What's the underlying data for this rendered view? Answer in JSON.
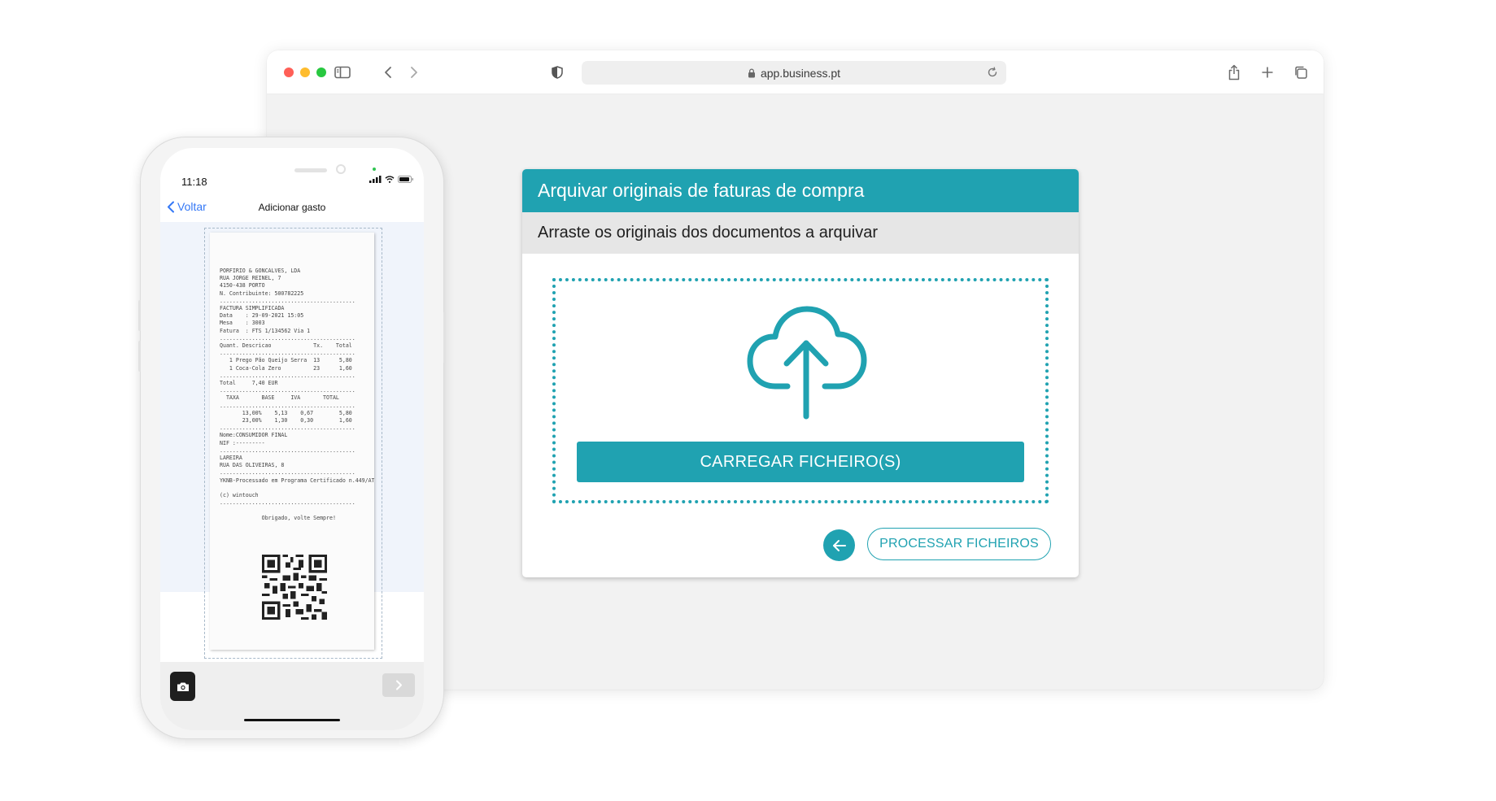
{
  "browser": {
    "url": "app.business.pt",
    "icons": {
      "sidebar": "sidebar-icon",
      "back": "chevron-left-icon",
      "forward": "chevron-right-icon",
      "privacy": "shield-icon",
      "lock": "lock-icon",
      "reload": "reload-icon",
      "share": "share-icon",
      "new_tab": "plus-icon",
      "tabs": "tabs-overview-icon"
    }
  },
  "card": {
    "title": "Arquivar originais de faturas de compra",
    "subtitle": "Arraste os originais dos documentos a arquivar",
    "upload_label": "CARREGAR FICHEIRO(S)",
    "process_label": "PROCESSAR FICHEIROS",
    "icons": {
      "cloud": "cloud-upload-icon",
      "back": "arrow-left-icon"
    }
  },
  "phone": {
    "time": "11:18",
    "back_label": "Voltar",
    "title": "Adicionar gasto",
    "receipt_text": "PORFIRIO & GONCALVES, LDA\nRUA JORGE REINEL, 7\n4150-438 PORTO\nN. Contribuinte: 500782225\n..........................................\nFACTURA SIMPLIFICADA\nData    : 29-09-2021 15:05\nMesa    : 3003\nFatura  : FTS 1/134562 Via 1\n..........................................\nQuant. Descricao             Tx.    Total\n..........................................\n   1 Prego Pão Queijo Serra  13      5,80\n   1 Coca-Cola Zero          23      1,60\n..........................................\nTotal     7,40 EUR\n..........................................\n  TAXA       BASE     IVA       TOTAL\n..........................................\n       13,00%    5,13    0,67        5,80\n       23,00%    1,30    0,30        1,60\n..........................................\nNome:CONSUMIDOR FINAL\nNIF :---------\n..........................................\nLAREIRA\nRUA DAS OLIVEIRAS, 8\n..........................................\nYKNB-Processado em Programa Certificado n.449/AT\n\n(c) wintouch\n..........................................\n\n             Obrigado, volte Sempre!",
    "icons": {
      "camera": "camera-icon",
      "next": "chevron-right-icon"
    },
    "accent": "#3478f6"
  },
  "colors": {
    "brand": "#20a2b1",
    "header_bg": "#e6e6e6",
    "window_bg": "#f2f2f2"
  }
}
